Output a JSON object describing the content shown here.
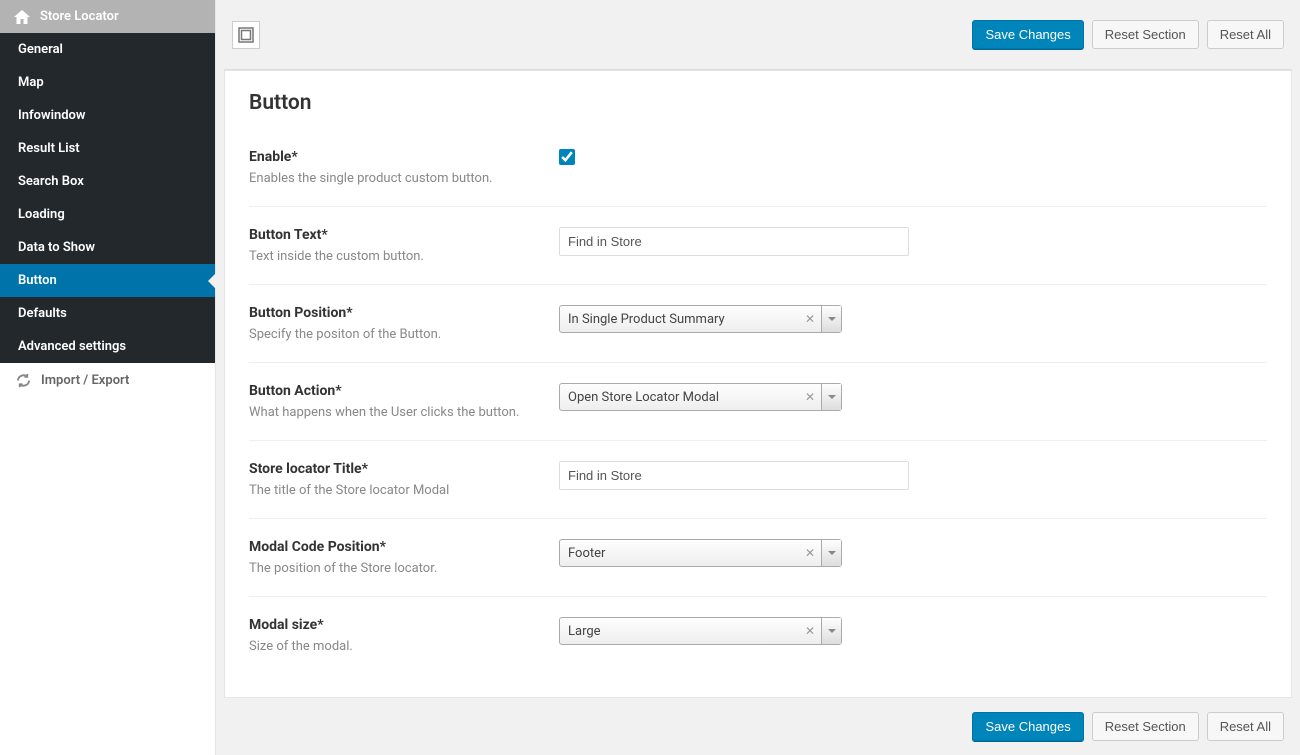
{
  "sidebar": {
    "header": "Store Locator",
    "items": [
      {
        "label": "General"
      },
      {
        "label": "Map"
      },
      {
        "label": "Infowindow"
      },
      {
        "label": "Result List"
      },
      {
        "label": "Search Box"
      },
      {
        "label": "Loading"
      },
      {
        "label": "Data to Show"
      },
      {
        "label": "Button",
        "active": true
      },
      {
        "label": "Defaults"
      },
      {
        "label": "Advanced settings"
      }
    ],
    "footer": "Import / Export"
  },
  "actions": {
    "save": "Save Changes",
    "reset_section": "Reset Section",
    "reset_all": "Reset All"
  },
  "section": {
    "title": "Button",
    "fields": {
      "enable": {
        "label": "Enable*",
        "desc": "Enables the single product custom button."
      },
      "button_text": {
        "label": "Button Text*",
        "desc": "Text inside the custom button.",
        "value": "Find in Store"
      },
      "button_position": {
        "label": "Button Position*",
        "desc": "Specify the positon of the Button.",
        "value": "In Single Product Summary"
      },
      "button_action": {
        "label": "Button Action*",
        "desc": "What happens when the User clicks the button.",
        "value": "Open Store Locator Modal"
      },
      "locator_title": {
        "label": "Store locator Title*",
        "desc": "The title of the Store locator Modal",
        "value": "Find in Store"
      },
      "modal_position": {
        "label": "Modal Code Position*",
        "desc": "The position of the Store locator.",
        "value": "Footer"
      },
      "modal_size": {
        "label": "Modal size*",
        "desc": "Size of the modal.",
        "value": "Large"
      }
    }
  }
}
